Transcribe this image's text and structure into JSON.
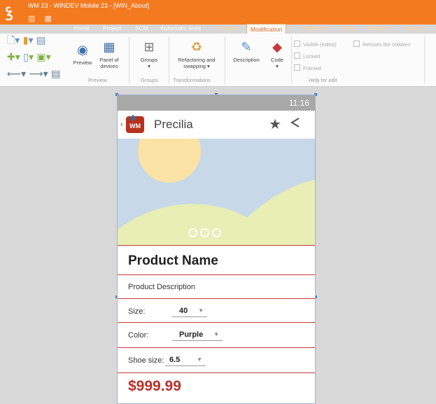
{
  "window": {
    "title": "WM 23 - WINDEV Mobile 23 - [WIN_About]"
  },
  "tabs": [
    "Home",
    "Project",
    "SCM",
    "Automatic tests",
    "Creation",
    "Modification",
    "Alignment",
    "Style",
    "Window",
    "Display"
  ],
  "ribbon": {
    "preview_label": "Preview",
    "panel_label": "Panel of devices",
    "groups_label": "Groups",
    "refactor_label": "Refactoring and swapping",
    "description_label": "Description",
    "code_label": "Code",
    "group_names": [
      "Preview",
      "Groups",
      "Transformations",
      "Help for edit"
    ],
    "checks": [
      "Visible (editor)",
      "Locked",
      "Framed",
      "Refuses the children"
    ]
  },
  "device": {
    "time": "11:16",
    "app_title": "Precilia",
    "logo_text": "WM",
    "product_name": "Product Name",
    "product_description": "Product Description",
    "size_label": "Size:",
    "size_value": "40",
    "color_label": "Color:",
    "color_value": "Purple",
    "shoe_label": "Shoe size:",
    "shoe_value": "6.5",
    "price": "$999.99"
  },
  "colors": {
    "accent": "#f47a20",
    "separator": "#c43b3b",
    "price": "#b9302a"
  }
}
